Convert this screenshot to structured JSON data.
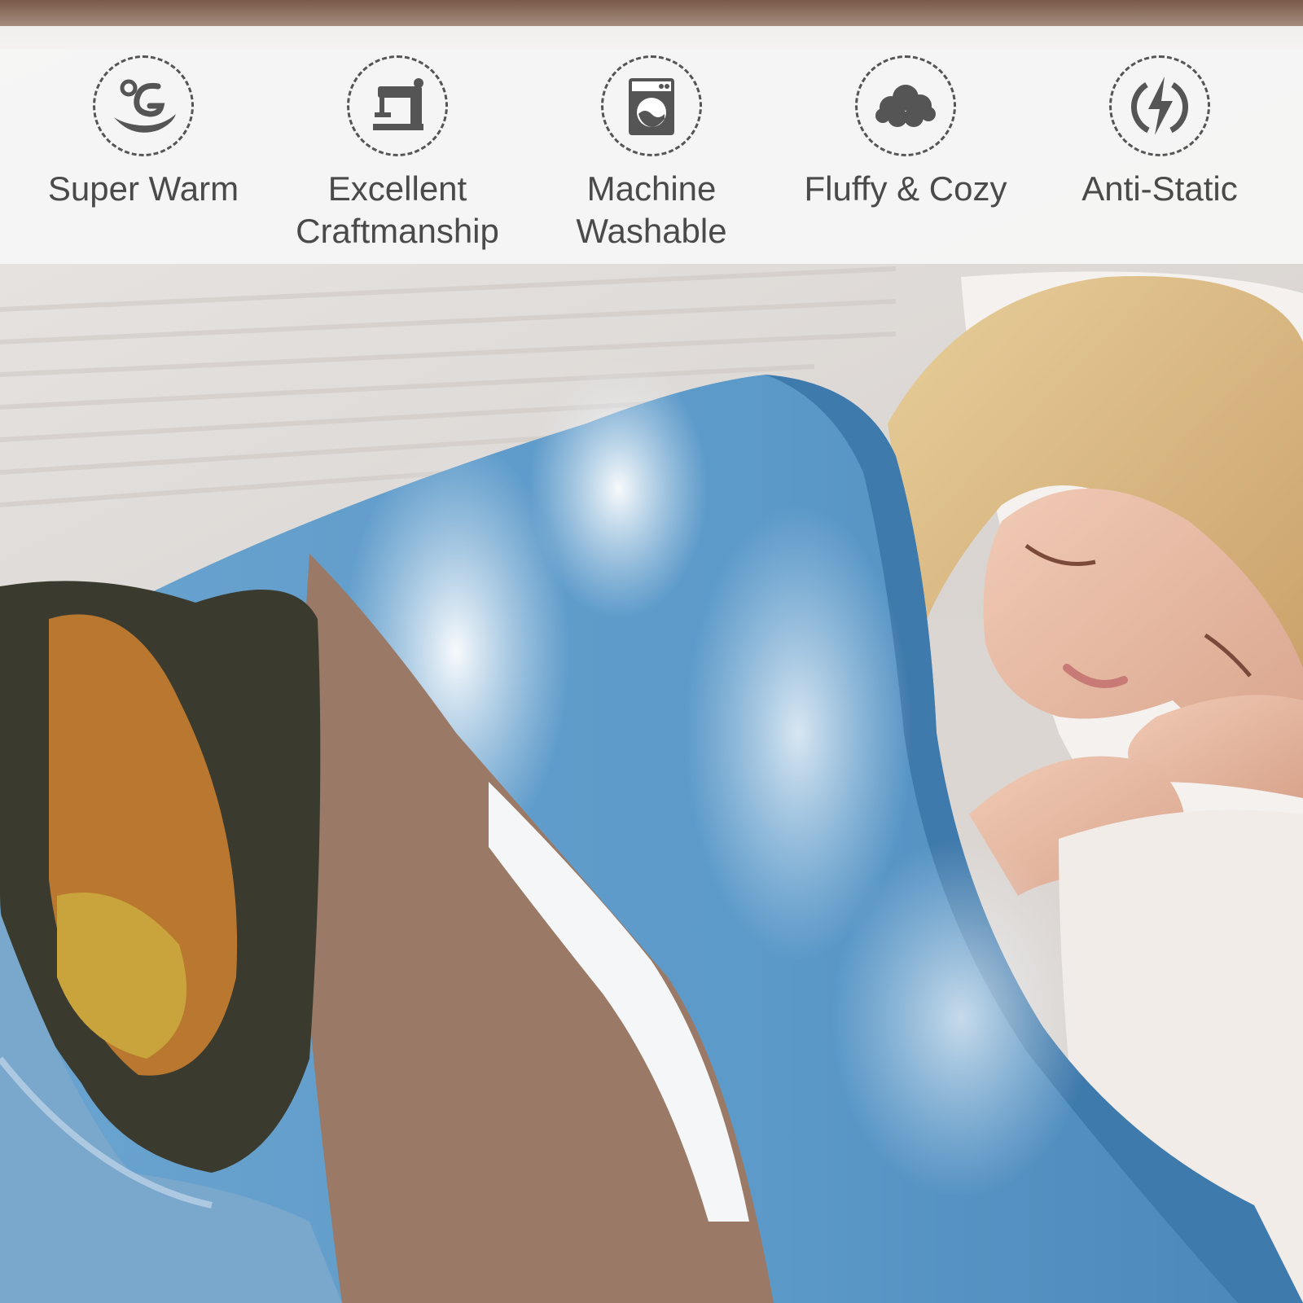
{
  "banner": {
    "features": [
      {
        "label": "Super Warm",
        "icon": "warm-swirl-icon"
      },
      {
        "label": "Excellent\nCraftmanship",
        "icon": "sewing-machine-icon"
      },
      {
        "label": "Machine\nWashable",
        "icon": "washing-machine-icon"
      },
      {
        "label": "Fluffy & Cozy",
        "icon": "cloud-icon"
      },
      {
        "label": "Anti-Static",
        "icon": "lightning-bolt-icon"
      }
    ]
  },
  "colors": {
    "banner_bg": "#f6f6f6",
    "icon_dark": "#555555",
    "text": "#4a4a4a",
    "blanket_blue": "#4d8fc0"
  }
}
